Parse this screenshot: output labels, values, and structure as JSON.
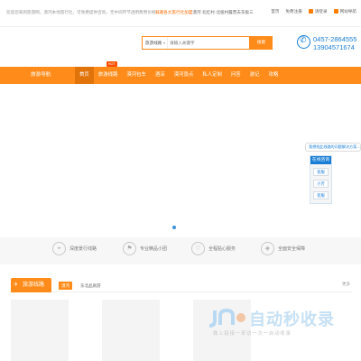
{
  "topbar": {
    "welcome": "欢迎您来到旅游网，漠河本地旅行社，可免费提供咨询，无中间环节透明费用价格！",
    "notice_lead": "诚邀各大旅行社加盟",
    "notice_rest": "漠河·北红村·北极村露营去东极三",
    "links": [
      "首页",
      "免费注册",
      "请登录",
      "网站导航"
    ]
  },
  "search": {
    "category": "旅游线路",
    "placeholder": "请输入关键字",
    "button": "搜索"
  },
  "contact": {
    "phone1": "0457-2864555",
    "phone2": "13904571674"
  },
  "nav": {
    "brand": "旅游导航",
    "items": [
      {
        "label": "首页",
        "active": true
      },
      {
        "label": "旅游线路",
        "badge": "HOT"
      },
      {
        "label": "漠河包车"
      },
      {
        "label": "酒店"
      },
      {
        "label": "漠河景点"
      },
      {
        "label": "私人定制"
      },
      {
        "label": "问答"
      },
      {
        "label": "游记"
      },
      {
        "label": "攻略"
      }
    ]
  },
  "float": {
    "tip": "我想找此线路的问题解决方案...",
    "head": "在线咨询",
    "items": [
      "客服",
      "小芳",
      "客服"
    ]
  },
  "features": [
    {
      "label": "深度景行线路",
      "icon": "map-icon"
    },
    {
      "label": "专业精品小团",
      "icon": "group-icon"
    },
    {
      "label": "全程贴心服务",
      "icon": "service-icon"
    },
    {
      "label": "全面安全保障",
      "icon": "shield-icon"
    }
  ],
  "section": {
    "title": "旅游线路",
    "tabs": [
      "漠河",
      "东北品质游"
    ],
    "more": "更多"
  },
  "watermark": {
    "title": "自动秒收录",
    "subtitle": "做上链接一来访一次一自动收录"
  },
  "colors": {
    "accent": "#ff8c1a",
    "phone": "#1a7ed6"
  }
}
